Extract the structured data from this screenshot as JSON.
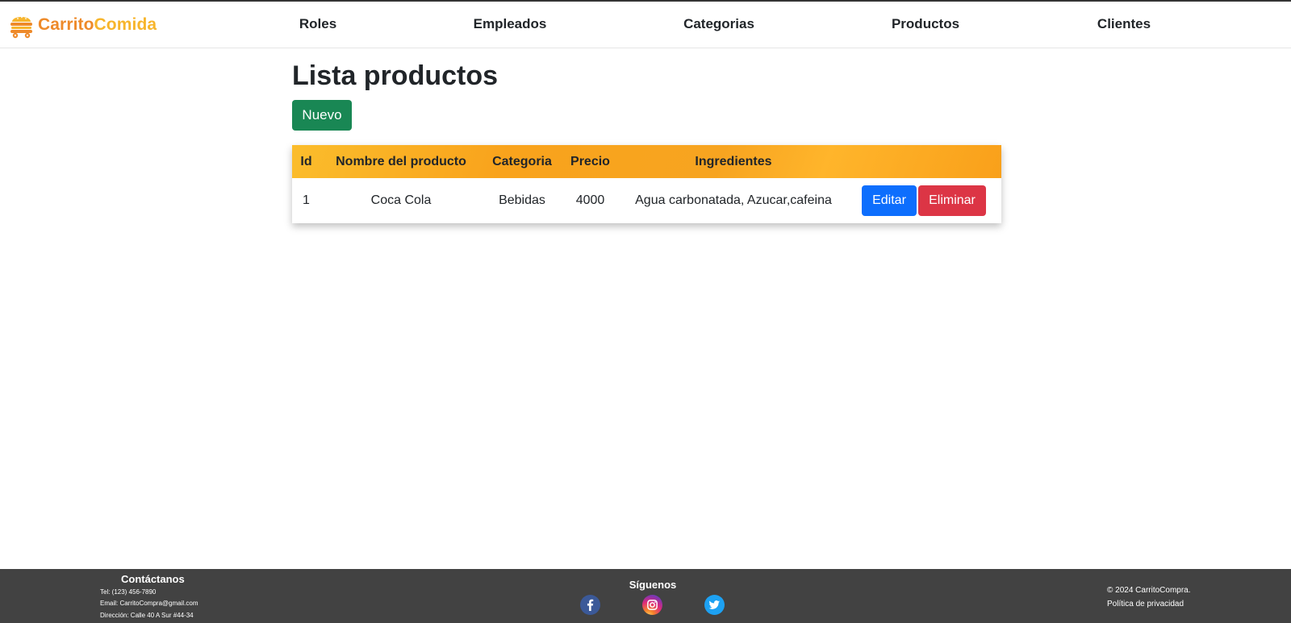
{
  "brand": {
    "name_part1": "Carrito",
    "name_part2": "Comida",
    "logo_icon": "food-cart-icon",
    "colors": {
      "primary": "#ee8a2a",
      "secondary": "#f7b52c"
    }
  },
  "nav": {
    "items": [
      {
        "label": "Roles"
      },
      {
        "label": "Empleados"
      },
      {
        "label": "Categorias"
      },
      {
        "label": "Productos"
      },
      {
        "label": "Clientes"
      }
    ]
  },
  "main": {
    "title": "Lista productos",
    "new_button": "Nuevo",
    "table": {
      "headers": [
        "Id",
        "Nombre del producto",
        "Categoria",
        "Precio",
        "Ingredientes",
        ""
      ],
      "rows": [
        {
          "id": "1",
          "name": "Coca Cola",
          "category": "Bebidas",
          "price": "4000",
          "ingredients": "Agua carbonatada, Azucar,cafeina",
          "edit_label": "Editar",
          "delete_label": "Eliminar"
        }
      ]
    }
  },
  "footer": {
    "contact": {
      "title": "Contáctanos",
      "phone": "Tel: (123) 456-7890",
      "email": "Email: CarritoCompra@gmail.com",
      "address": "Dirección: Calle 40 A Sur #44-34"
    },
    "social": {
      "title": "Síguenos",
      "icons": [
        "facebook-icon",
        "instagram-icon",
        "twitter-icon"
      ]
    },
    "copyright": "© 2024 CarritoCompra.",
    "privacy": "Política de privacidad"
  },
  "colors": {
    "header_gradient": "#f9a31c",
    "success": "#198754",
    "primary": "#0d6efd",
    "danger": "#dc3545",
    "footer_bg": "#424242"
  }
}
